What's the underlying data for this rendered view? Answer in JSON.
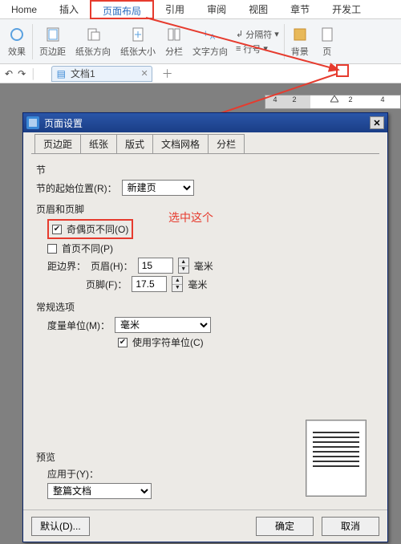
{
  "ribbon": {
    "tabs": [
      "Home",
      "插入",
      "页面布局",
      "引用",
      "审阅",
      "视图",
      "章节",
      "开发工"
    ],
    "active_index": 2,
    "groups": {
      "effect": "效果",
      "margins": "页边距",
      "orientation": "纸张方向",
      "size": "纸张大小",
      "columns": "分栏",
      "textdir": "文字方向",
      "breaks": "分隔符",
      "linenum": "行号",
      "background": "背景",
      "page": "页"
    }
  },
  "qat": {
    "doc_tab": "文档1"
  },
  "ruler": {
    "labels": [
      "4",
      "2",
      "2",
      "4"
    ]
  },
  "dialog": {
    "title": "页面设置",
    "tabs": [
      "页边距",
      "纸张",
      "版式",
      "文档网格",
      "分栏"
    ],
    "active_tab_index": 2,
    "section": {
      "group": "节",
      "start_label": "节的起始位置(R)：",
      "start_value": "新建页"
    },
    "headerfooter": {
      "group": "页眉和页脚",
      "odd_even": "奇偶页不同(O)",
      "odd_even_checked": true,
      "first_diff": "首页不同(P)",
      "first_diff_checked": false,
      "distance_label": "距边界：",
      "header_label": "页眉(H)：",
      "header_value": "15",
      "footer_label": "页脚(F)：",
      "footer_value": "17.5",
      "unit": "毫米"
    },
    "general": {
      "group": "常规选项",
      "measure_label": "度量单位(M)：",
      "measure_value": "毫米",
      "use_char": "使用字符单位(C)",
      "use_char_checked": true
    },
    "preview": {
      "group": "预览",
      "apply_label": "应用于(Y)：",
      "apply_value": "整篇文档"
    },
    "buttons": {
      "default": "默认(D)...",
      "ok": "确定",
      "cancel": "取消"
    }
  },
  "callout": {
    "text": "选中这个"
  },
  "colors": {
    "accent_red": "#e63b2e",
    "ribbon_blue": "#2a6cbf",
    "title_blue": "#1a3e86"
  }
}
